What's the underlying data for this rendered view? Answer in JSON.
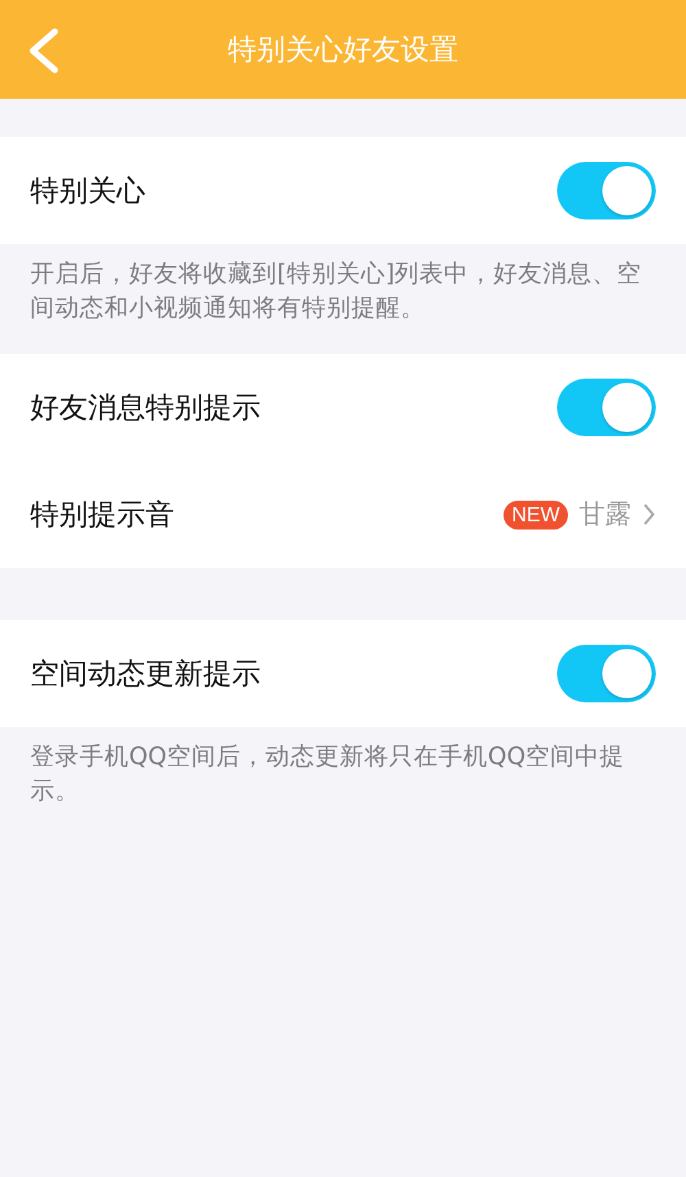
{
  "header": {
    "title": "特别关心好友设置"
  },
  "sections": [
    {
      "rows": [
        {
          "kind": "toggle",
          "label": "特别关心",
          "on": true
        }
      ],
      "note": "开启后，好友将收藏到[特别关心]列表中，好友消息、空间动态和小视频通知将有特别提醒。"
    },
    {
      "rows": [
        {
          "kind": "toggle",
          "label": "好友消息特别提示",
          "on": true
        },
        {
          "kind": "value",
          "label": "特别提示音",
          "badge": "NEW",
          "value": "甘露"
        }
      ]
    },
    {
      "rows": [
        {
          "kind": "toggle",
          "label": "空间动态更新提示",
          "on": true
        }
      ],
      "note": "登录手机QQ空间后，动态更新将只在手机QQ空间中提示。"
    }
  ]
}
